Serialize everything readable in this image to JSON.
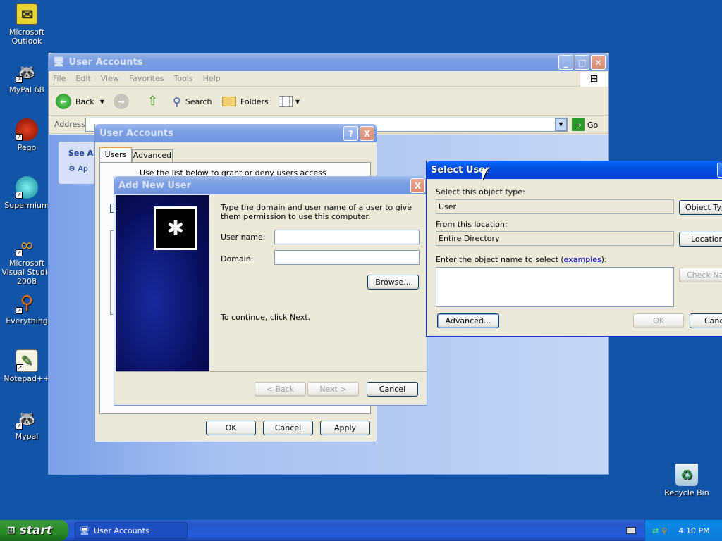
{
  "desktop": {
    "icons": [
      {
        "label": "Microsoft Outlook",
        "icon": "outlook-icon"
      },
      {
        "label": "MyPal 68",
        "icon": "mypal-icon"
      },
      {
        "label": "Pego",
        "icon": "pego-icon"
      },
      {
        "label": "Supermium",
        "icon": "supermium-icon"
      },
      {
        "label": "Microsoft Visual Studio 2008",
        "icon": "visual-studio-icon"
      },
      {
        "label": "Everything",
        "icon": "everything-icon"
      },
      {
        "label": "Notepad++",
        "icon": "notepad-plus-plus-icon"
      },
      {
        "label": "Mypal",
        "icon": "mypal-icon"
      },
      {
        "label": "Recycle Bin",
        "icon": "recycle-bin-icon"
      }
    ]
  },
  "explorer": {
    "title": "User Accounts",
    "menu": [
      "File",
      "Edit",
      "View",
      "Favorites",
      "Tools",
      "Help"
    ],
    "toolbar": {
      "back": "Back",
      "search": "Search",
      "folders": "Folders"
    },
    "address_label": "Address",
    "go": "Go",
    "see_also": "See Al",
    "see_also_item": "Ap"
  },
  "ua_dialog": {
    "title": "User Accounts",
    "tabs": [
      "Users",
      "Advanced"
    ],
    "text_fragment": "Use the list below to grant or deny users access",
    "ok": "OK",
    "cancel": "Cancel",
    "apply": "Apply",
    "help": "?",
    "close": "X"
  },
  "add_user": {
    "title": "Add New User",
    "intro": "Type the domain and user name of a user to give them permission to use this computer.",
    "username_label": "User name:",
    "domain_label": "Domain:",
    "username_value": "",
    "domain_value": "",
    "browse": "Browse...",
    "continue": "To continue, click Next.",
    "back": "< Back",
    "next": "Next >",
    "cancel": "Cancel",
    "close": "X"
  },
  "select_user": {
    "title": "Select User",
    "object_type_label": "Select this object type:",
    "object_type_value": "User",
    "object_types_button": "Object Typ",
    "location_label": "From this location:",
    "location_value": "Entire Directory",
    "locations_button": "Locations",
    "enter_label_prefix": "Enter the object name to select (",
    "examples_link": "examples",
    "enter_label_suffix": "):",
    "check_names": "Check Na",
    "advanced": "Advanced...",
    "ok": "OK",
    "cancel": "Canc"
  },
  "taskbar": {
    "start": "start",
    "task": "User Accounts",
    "clock": "4:10 PM"
  },
  "colors": {
    "desktop": "#1254a8",
    "titlebar": "#0450e0",
    "dialog": "#ece9d8"
  }
}
